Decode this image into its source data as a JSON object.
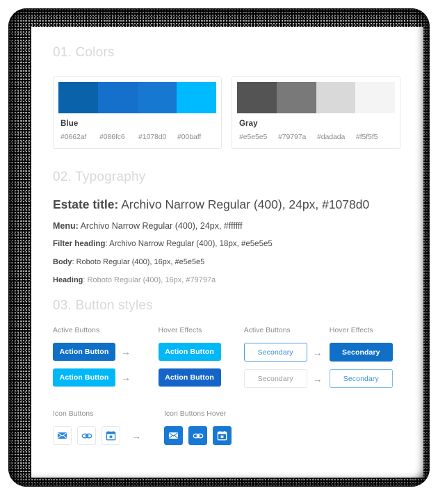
{
  "sections": [
    {
      "id": "colors",
      "title": "01. Colors"
    },
    {
      "id": "typography",
      "title": "02. Typography"
    },
    {
      "id": "buttons",
      "title": "03. Button styles"
    }
  ],
  "palettes": [
    {
      "name": "Blue",
      "swatch_colors": [
        "#0a62ab",
        "#1470ca",
        "#1778d2",
        "#00baff"
      ],
      "hex_labels": [
        "#0662af",
        "#086fc6",
        "#1078d0",
        "#00baff"
      ]
    },
    {
      "name": "Gray",
      "swatch_colors": [
        "#545454",
        "#797979",
        "#d9d9d9",
        "#f4f4f4"
      ],
      "hex_labels": [
        "#e5e5e5",
        "#79797a",
        "#dadada",
        "#f5f5f5"
      ]
    }
  ],
  "typography": [
    {
      "lead": "Estate title:",
      "rest": " Archivo Narrow Regular (400), 24px, #1078d0"
    },
    {
      "lead": "Menu:",
      "rest": " Archivo Narrow Regular (400), 24px, #ffffff"
    },
    {
      "lead": "Filter heading",
      "rest": ": Archivo Narrow Regular (400), 18px, #e5e5e5"
    },
    {
      "lead": "Body",
      "rest": ": Roboto Regular (400), 16px, #e5e5e5"
    },
    {
      "lead": "Heading",
      "rest": ": Roboto Regular (400), 16px, #79797a"
    }
  ],
  "buttons": {
    "arrow_glyph": "→",
    "primary_group": {
      "active_label": "Active Buttons",
      "hover_label": "Hover Effects",
      "rows": [
        {
          "active_text": "Action Button",
          "active_bg": "#1070c8",
          "hover_text": "Action Button",
          "hover_bg": "#00b8f8"
        },
        {
          "active_text": "Action Button",
          "active_bg": "#00b8f8",
          "hover_text": "Action Button",
          "hover_bg": "#1565c8"
        }
      ]
    },
    "secondary_group": {
      "active_label": "Active Buttons",
      "hover_label": "Hover Effects",
      "rows": [
        {
          "active_text": "Secondary",
          "active_bg": "#ffffff",
          "active_border": "#4a9ae8",
          "active_color": "#3c8fe0",
          "hover_text": "Secondary",
          "hover_bg": "#1070c8",
          "hover_border": "#1070c8",
          "hover_color": "#ffffff"
        },
        {
          "active_text": "Secondary",
          "active_bg": "#ffffff",
          "active_border": "#e8e8e8",
          "active_color": "#9b9b9b",
          "hover_text": "Secondary",
          "hover_bg": "#ffffff",
          "hover_border": "#7fb8ee",
          "hover_color": "#3c8fe0"
        }
      ]
    },
    "icon_group": {
      "plain_label": "Icon Buttons",
      "hover_label": "Icon Buttons Hover",
      "icons": [
        "envelope-icon",
        "link-icon",
        "calendar-icon"
      ],
      "plain_icon_color": "#2a85dd",
      "hover_bg": "#1878d4",
      "hover_icon_color": "#ffffff"
    }
  }
}
